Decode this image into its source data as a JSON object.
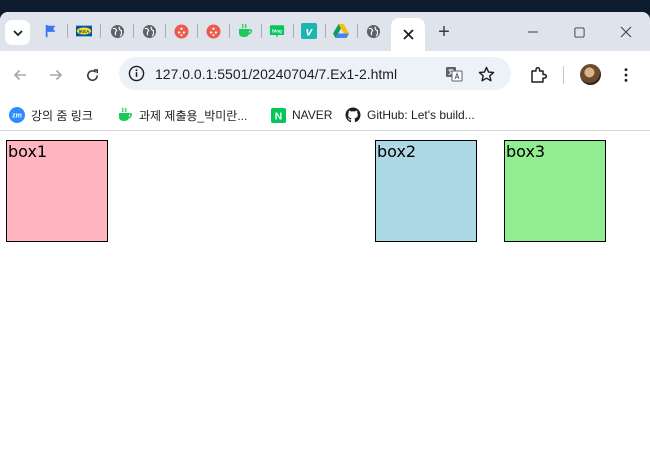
{
  "browser": {
    "tabs": [
      {
        "icon": "flag-icon",
        "color": "#3a78f2"
      },
      {
        "icon": "ikea-icon",
        "color": "#0058a3"
      },
      {
        "icon": "globe-icon",
        "color": "#5f6368"
      },
      {
        "icon": "globe-icon",
        "color": "#5f6368"
      },
      {
        "icon": "youtube-shorts-icon",
        "color": "#ef5a4f"
      },
      {
        "icon": "youtube-shorts-icon",
        "color": "#ef5a4f"
      },
      {
        "icon": "cup-icon",
        "color": "#1ec95b"
      },
      {
        "icon": "blog-icon",
        "color": "#03c75a"
      },
      {
        "icon": "vimeo-icon",
        "color": "#19b7ad"
      },
      {
        "icon": "google-drive-icon",
        "color": "#1a73e8"
      },
      {
        "icon": "globe-icon",
        "color": "#5f6368"
      }
    ],
    "ikea_label": "IKEA",
    "blog_label": "blog",
    "vimeo_label": "v",
    "zm_label": "zm",
    "naver_logo_letter": "N",
    "new_tab_label": "+",
    "address": {
      "url": "127.0.0.1:5501/20240704/7.Ex1-2.html"
    }
  },
  "bookmarks": [
    {
      "label": "강의 줌 링크",
      "icon": "zoom-icon"
    },
    {
      "label": "과제 제출용_박미란...",
      "icon": "cup-icon"
    },
    {
      "label": "NAVER",
      "icon": "naver-icon"
    },
    {
      "label": "GitHub: Let's build...",
      "icon": "github-icon"
    }
  ],
  "page": {
    "boxes": [
      {
        "label": "box1",
        "color": "#ffb6c1"
      },
      {
        "label": "box2",
        "color": "#add8e6"
      },
      {
        "label": "box3",
        "color": "#90ee90"
      }
    ]
  }
}
